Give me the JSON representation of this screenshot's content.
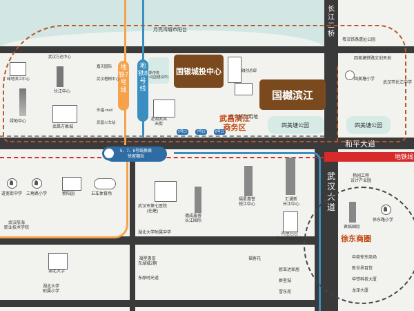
{
  "roads": {
    "changjiang_bridge": "长江二桥",
    "heping_avenue": "和平大道",
    "wuhan_avenue": "武汉大道",
    "metro_tag": "地铁线"
  },
  "metro": {
    "line7": "地铁7号线",
    "line8": "地铁8号线",
    "transfer": "5、7、8号线换乘",
    "transfer_station": "徐家棚站",
    "station_badges": [
      "5号口",
      "7号口",
      "8号口"
    ]
  },
  "highlights": {
    "investment_center": "国银城投中心",
    "guoshu_binjiang": "国樾滨江",
    "business_district": "武昌滨江\n商务区",
    "xu_dong_circle": "徐东商圈"
  },
  "top_labels": {
    "yuejiang_park": "月亮湾城市阳台",
    "aoshan_park": "粤汉铁路遗址公园",
    "siwei_park_top": "四美塘铁路文创天地",
    "sim_primary": "四美塘小学",
    "wuhan_middle": "武汉市长江中学",
    "siwei_park": "四美塘公园",
    "siwei_park_right": "四美塘公园",
    "changjiang_center": "长江中心",
    "green_center": "绿地中心",
    "wuchang_wanxiang": "武昌万象城",
    "liangyuan": "绿地滨江中心",
    "wanda": "武汉万达中心",
    "jiatian_hotel": "嘉天国际",
    "lefu": "乐福·mall",
    "wuchang_station": "武昌火车站",
    "wutong_center": "武汉梧桐中心",
    "xinzhong": "新中央\n公园(建设中)",
    "dazhai": "大寨",
    "zhongshang": "融创总部",
    "jiaoyu": "教育规划用地",
    "longhu": "龙湖武昌\n天街",
    "other_block": "东湖国际"
  },
  "bottom_labels": {
    "daoyu": "道宽街中学",
    "sanjiao": "三角路小学",
    "ziyang": "紫阳园",
    "wuche": "五车体育场",
    "vocational": "武汉航海\n职业技术学院",
    "hospital7": "武汉市第七医院\n(在建)",
    "dexun": "德成鑫睿\n长江国际",
    "hubei_affil": "湖北大学附属中学",
    "fuxing": "福星惠誉\n锐江中心",
    "huitong": "汇通新\n长江中心",
    "alibaba": "阿里巴巴\n华中总部(在建)",
    "fuxing2": "福星惠誉\n东湖城2期",
    "dongyuan": "东原时光道",
    "hubei_univ": "湖北大学",
    "hubei_affil2": "湖北大学\n附属小学",
    "fuxing_office": "福客花",
    "wanda_xinan": "欧亚达家居",
    "qunxing": "群星城",
    "xuedong": "雪东苑",
    "yanzi": "杨园工程\n设计产业园",
    "junlin": "君临国际",
    "xudong_primary": "徐东路小学",
    "zhonghe": "中商徐东商场",
    "xinshijie": "新世界百货",
    "zhongke": "中铁科技大厦",
    "longze": "龙泽大厦"
  },
  "colors": {
    "road": "#3a3a3a",
    "river": "#d2e6e3",
    "metro7": "#f5a24b",
    "metro8": "#3a8fc0",
    "brown": "#7a4a1e",
    "business": "#c1480f",
    "dashed_orange": "#b9562a",
    "metro_red": "#d72b2b"
  }
}
